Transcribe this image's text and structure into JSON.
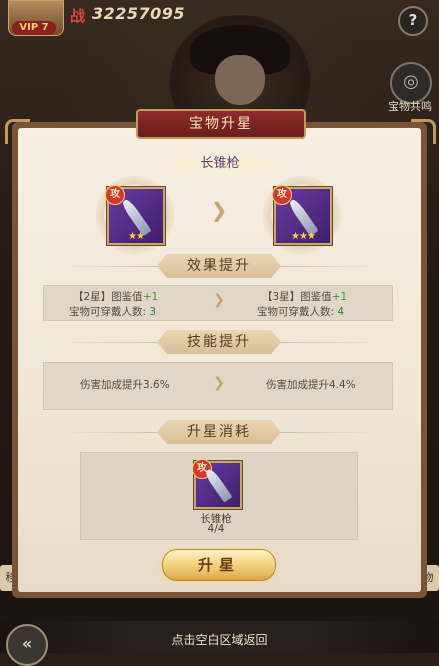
{
  "player": {
    "vip_label": "VIP 7",
    "power_icon_char": "战",
    "power_value": "32257095"
  },
  "top_right": {
    "help_label": "?",
    "share_label": "宝物共鸣"
  },
  "panel": {
    "title": "宝物升星",
    "item_name": "长锥枪",
    "current": {
      "badge": "攻",
      "stars": "★★"
    },
    "next": {
      "badge": "攻",
      "stars": "★★★"
    }
  },
  "effect": {
    "header": "效果提升",
    "left_line1_a": "【2星】图鉴值",
    "left_line1_b": "+1",
    "left_line2_a": "宝物可穿戴人数:",
    "left_line2_b": "3",
    "right_line1_a": "【3星】图鉴值",
    "right_line1_b": "+1",
    "right_line2_a": "宝物可穿戴人数:",
    "right_line2_b": "4"
  },
  "skill": {
    "header": "技能提升",
    "left_text": "伤害加成提升3.6%",
    "right_text": "伤害加成提升4.4%"
  },
  "consume": {
    "header": "升星消耗",
    "badge": "攻",
    "item_name": "长锥枪",
    "count": "4/4"
  },
  "actions": {
    "upgrade_label": "升星"
  },
  "footer": {
    "hint": "点击空白区域返回",
    "back_label": "«"
  },
  "side_tabs": {
    "left_char": "移",
    "right_char": "物"
  },
  "colors": {
    "title_banner": "#8f2c2c",
    "panel_bg": "#f6efe2",
    "accent_gold": "#c39a5e",
    "value_green": "#3a9a2a"
  }
}
